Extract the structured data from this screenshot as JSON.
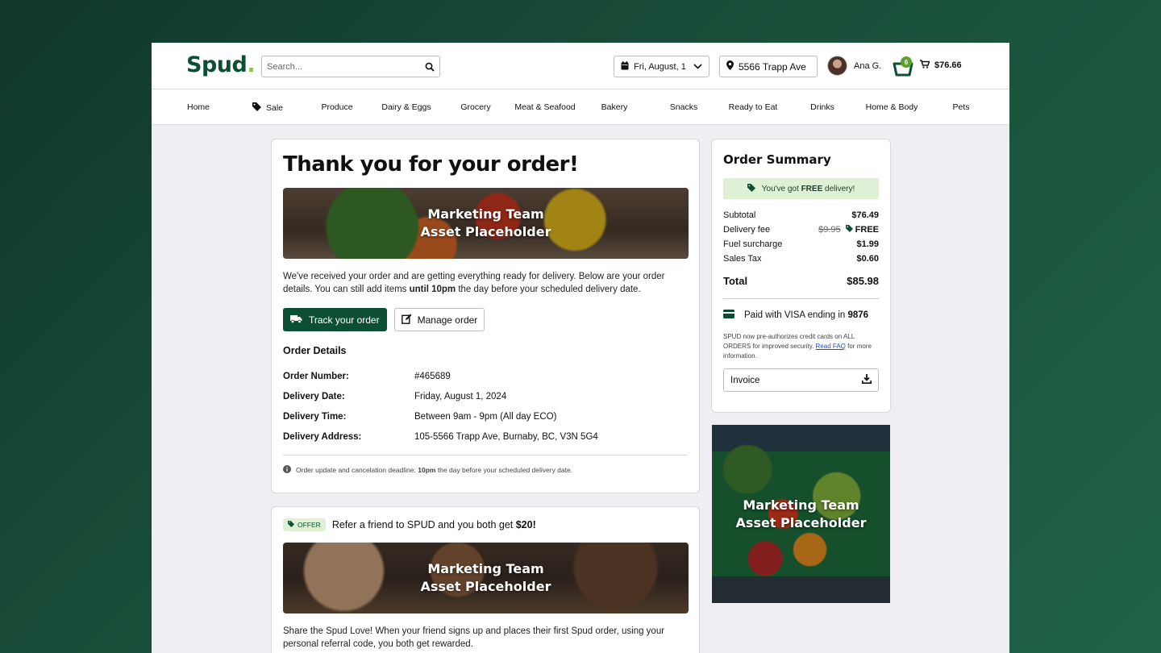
{
  "header": {
    "logo": "Spud",
    "logo_dot": ".",
    "search_placeholder": "Search...",
    "delivery_date": "Fri, August, 1",
    "address": "5566 Trapp Ave",
    "user_name": "Ana G.",
    "basket_count": "6",
    "cart_total": "$76.66"
  },
  "nav": {
    "items": [
      "Home",
      "Sale",
      "Produce",
      "Dairy & Eggs",
      "Grocery",
      "Meat & Seafood",
      "Bakery",
      "Snacks",
      "Ready to Eat",
      "Drinks",
      "Home & Body",
      "Pets"
    ]
  },
  "confirmation": {
    "title": "Thank you for your order!",
    "hero_line1": "Marketing Team",
    "hero_line2": "Asset Placeholder",
    "message_before": "We've received your order and are getting everything ready for delivery. Below are your order details. You can still add items ",
    "message_bold": "until 10pm",
    "message_after": " the day before your scheduled delivery date.",
    "track_button": "Track your order",
    "manage_button": "Manage order",
    "details_title": "Order Details",
    "details": [
      {
        "label": "Order Number:",
        "value": "#465689"
      },
      {
        "label": "Delivery Date:",
        "value": "Friday, August 1, 2024"
      },
      {
        "label": "Delivery Time:",
        "value": "Between 9am - 9pm (All day ECO)"
      },
      {
        "label": "Delivery Address:",
        "value": "105-5566 Trapp Ave, Burnaby, BC, V3N 5G4"
      }
    ],
    "note_before": "Order update and cancelation deadline: ",
    "note_bold": "10pm",
    "note_after": " the day before your scheduled delivery date."
  },
  "offer": {
    "tag": "OFFER",
    "headline_before": "Refer a friend to SPUD and you both get ",
    "headline_bold": "$20!",
    "hero_line1": "Marketing Team",
    "hero_line2": "Asset Placeholder",
    "text": "Share the Spud Love! When your friend signs up and places their first Spud order, using your personal referral code, you both get rewarded."
  },
  "summary": {
    "title": "Order Summary",
    "free_before": "You've got ",
    "free_bold": "FREE",
    "free_after": " delivery!",
    "subtotal_label": "Subtotal",
    "subtotal_value": "$76.49",
    "delivery_label": "Delivery fee",
    "delivery_original": "$9.95",
    "delivery_value": "FREE",
    "fuel_label": "Fuel surcharge",
    "fuel_value": "$1.99",
    "tax_label": "Sales Tax",
    "tax_value": "$0.60",
    "total_label": "Total",
    "total_value": "$85.98",
    "paid_before": "Paid with VISA ending in ",
    "paid_bold": "9876",
    "fine_before": "SPUD now pre-authorizes credit cards on ALL ORDERS for improved security. ",
    "fine_link": "Read FAQ",
    "fine_after": " for more information.",
    "invoice_label": "Invoice"
  },
  "side_promo": {
    "line1": "Marketing Team",
    "line2": "Asset Placeholder"
  },
  "colors": {
    "brand": "#0d4f35",
    "accent": "#8cc63f",
    "free_bg": "#dff1d5"
  }
}
